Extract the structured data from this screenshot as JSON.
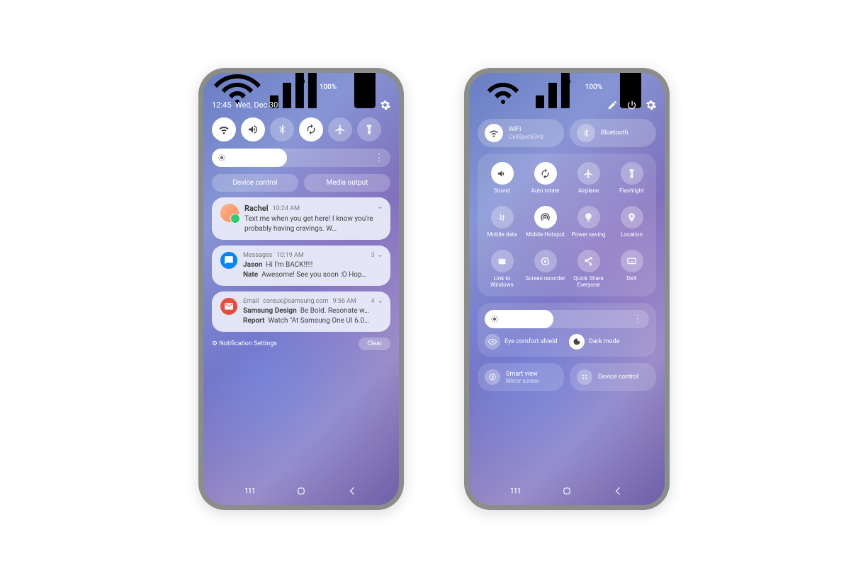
{
  "status": {
    "battery": "100%",
    "signal_icons": "wifi-signal-battery"
  },
  "p1": {
    "time": "12:45",
    "date": "Wed, Dec 30",
    "qs": [
      {
        "name": "wifi",
        "active": true
      },
      {
        "name": "sound",
        "active": true
      },
      {
        "name": "bluetooth",
        "active": false
      },
      {
        "name": "rotate",
        "active": true
      },
      {
        "name": "airplane",
        "active": false
      },
      {
        "name": "flashlight",
        "active": false
      }
    ],
    "device_control": "Device control",
    "media_output": "Media output",
    "notif1": {
      "name": "Rachel",
      "time": "10:24 AM",
      "body": "Text me when you get here! I know you're probably having cravings. W…"
    },
    "notif2": {
      "app": "Messages",
      "time": "10:19 AM",
      "count": "3",
      "l1n": "Jason",
      "l1b": "Hi I'm BACK!!!!!",
      "l2n": "Nate",
      "l2b": "Awesome! See you soon :O Hop…"
    },
    "notif3": {
      "app": "Email",
      "from": "coreux@samsung.com",
      "time": "9:56 AM",
      "count": "4",
      "l1n": "Samsung Design",
      "l1b": "Be Bold. Resonate w…",
      "l2n": "Report",
      "l2b": "Watch \"At Samsung One UI 6.0…"
    },
    "settings_link": "Notification Settings",
    "clear": "Clear"
  },
  "p2": {
    "wifi": {
      "label": "WiFi",
      "sub": "CellSpot5GHz"
    },
    "bt": {
      "label": "Bluetooth"
    },
    "tiles": [
      {
        "label": "Sound",
        "on": true,
        "icon": "sound"
      },
      {
        "label": "Auto rotate",
        "on": true,
        "icon": "rotate"
      },
      {
        "label": "Airplane",
        "on": false,
        "icon": "airplane"
      },
      {
        "label": "Flashlight",
        "on": false,
        "icon": "flashlight"
      },
      {
        "label": "Mobile data",
        "on": false,
        "icon": "mobiledata"
      },
      {
        "label": "Mobile Hotspot",
        "on": true,
        "icon": "hotspot"
      },
      {
        "label": "Power saving",
        "on": false,
        "icon": "powersave"
      },
      {
        "label": "Location",
        "on": false,
        "icon": "location"
      },
      {
        "label": "Link to Windows",
        "on": false,
        "icon": "link"
      },
      {
        "label": "Screen recorder",
        "on": false,
        "icon": "record"
      },
      {
        "label": "Quick Share Everyone",
        "on": false,
        "icon": "quickshare"
      },
      {
        "label": "DeX",
        "on": false,
        "icon": "dex"
      }
    ],
    "eye": "Eye comfort shield",
    "dark": "Dark mode",
    "smartview": {
      "label": "Smart view",
      "sub": "Mirror screen"
    },
    "devctrl": "Device control"
  }
}
